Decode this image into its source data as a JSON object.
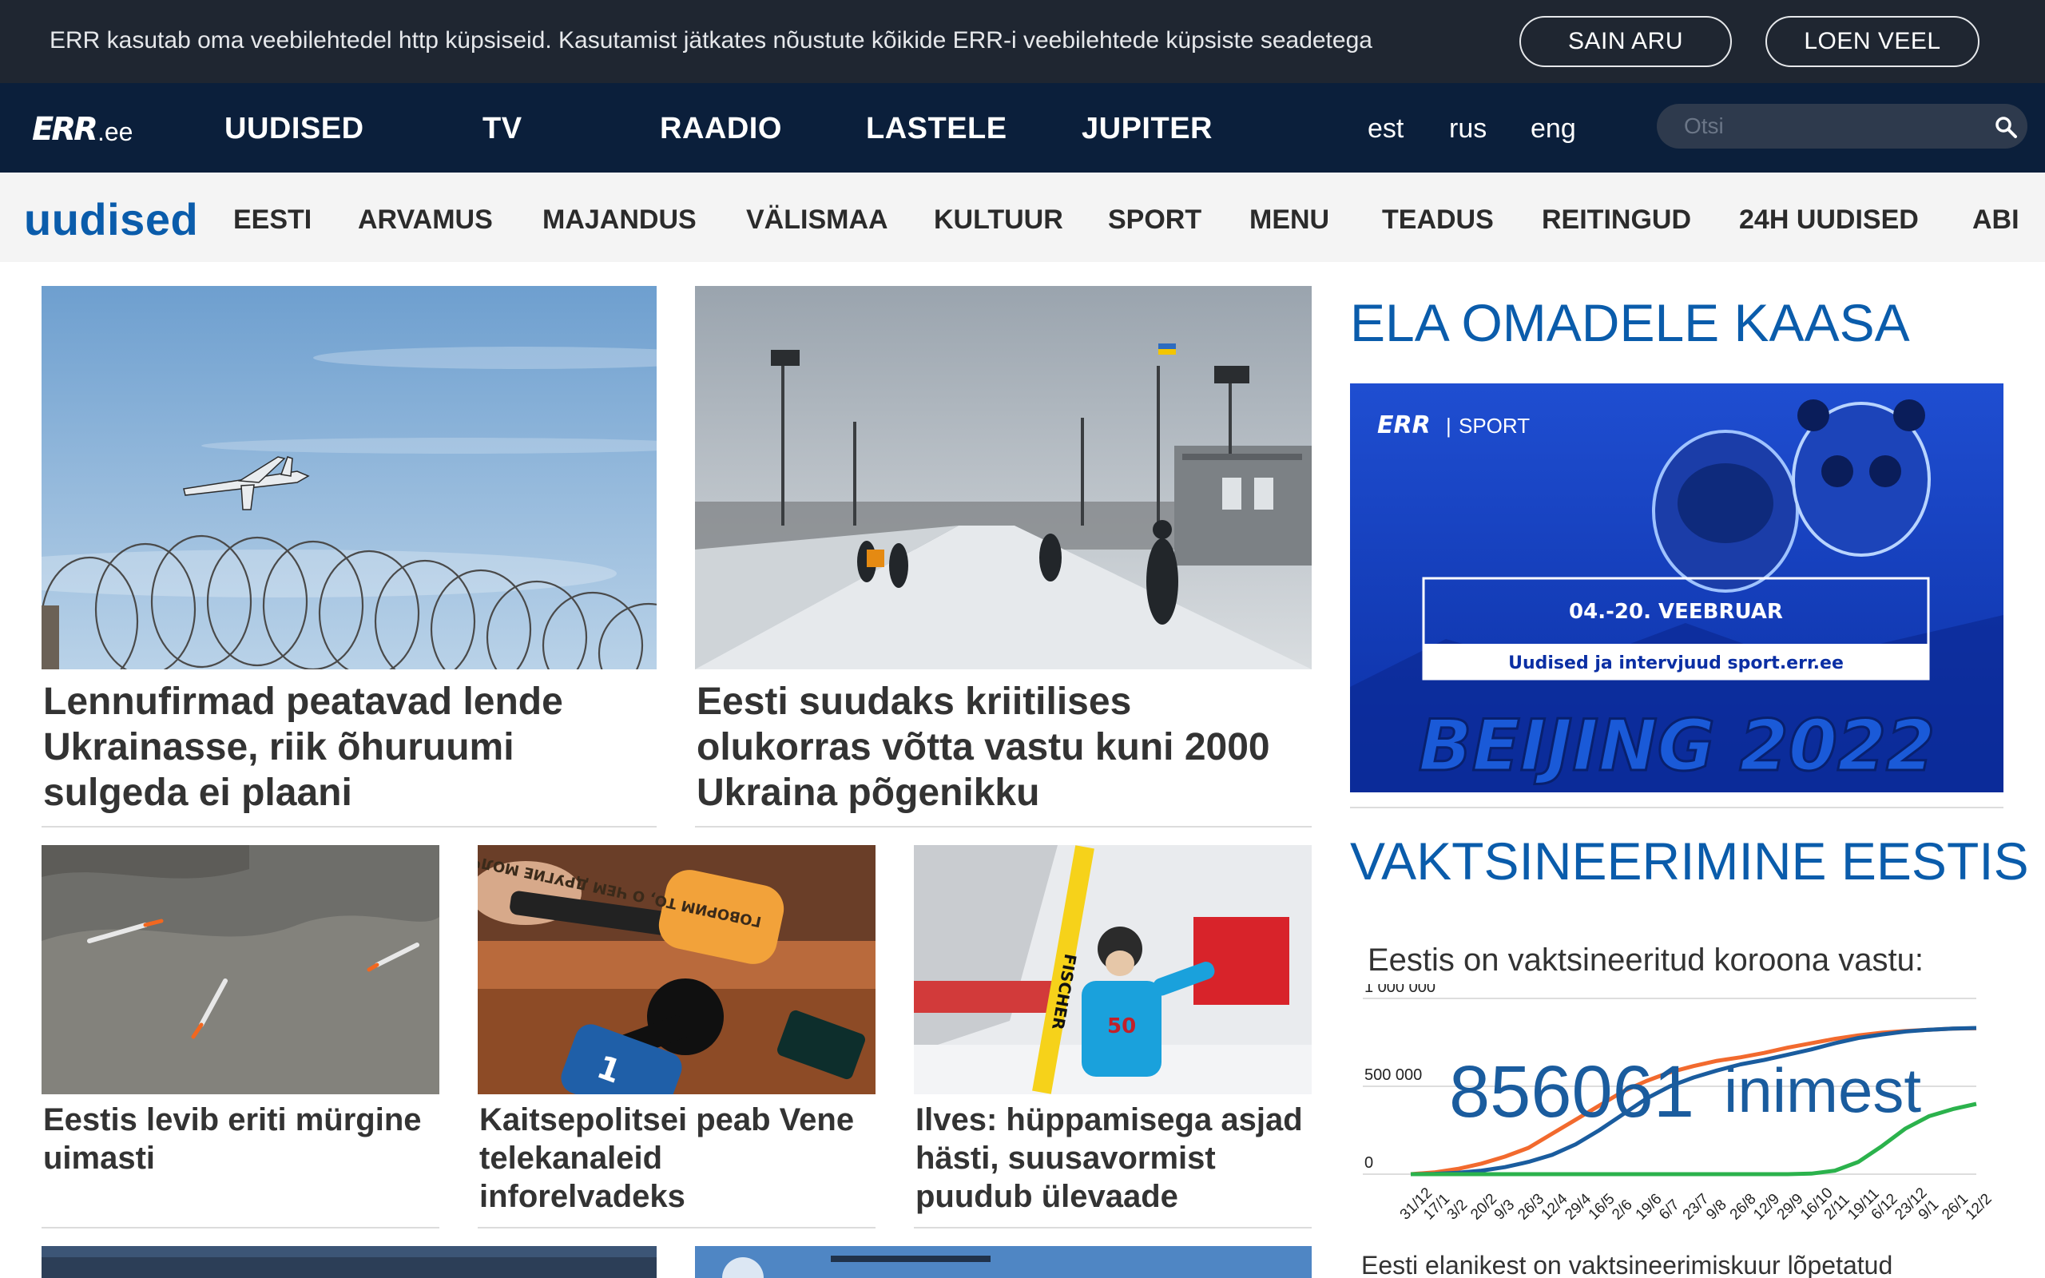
{
  "cookie": {
    "text": "ERR kasutab oma veebilehtedel http küpsiseid. Kasutamist jätkates nõustute kõikide ERR-i veebilehtede küpsiste seadetega",
    "accept_label": "SAIN ARU",
    "more_label": "LOEN VEEL"
  },
  "header": {
    "logo_mark": "ERR",
    "logo_suffix": ".ee",
    "nav": [
      "UUDISED",
      "TV",
      "RAADIO",
      "LASTELE",
      "JUPITER"
    ],
    "languages": [
      "est",
      "rus",
      "eng"
    ],
    "search_placeholder": "Otsi"
  },
  "section": {
    "title": "uudised",
    "items": [
      "EESTI",
      "ARVAMUS",
      "MAJANDUS",
      "VÄLISMAA",
      "KULTUUR",
      "SPORT",
      "MENU",
      "TEADUS",
      "REITINGUD",
      "24H UUDISED",
      "ABI"
    ]
  },
  "articles": {
    "lead1": {
      "title": "Lennufirmad peatavad lende Ukrainasse, riik õhuruumi sulgeda ei plaani"
    },
    "lead2": {
      "title": "Eesti suudaks kriitilises olukorras võtta vastu kuni 2000 Ukraina põgenikku"
    },
    "small1": {
      "title": "Eestis levib eriti mürgine uimasti"
    },
    "small2": {
      "title": "Kaitsepolitsei peab Vene telekanaleid inforelvadeks"
    },
    "small3": {
      "title": "Ilves: hüppamisega asjad hästi, suusavormist puudub ülevaade"
    },
    "mic_text": "ГОВОРИМ ТО, О ЧЕМ ДРУГИЕ МОЛЧАТ",
    "ski_bib": "50",
    "ski_brand": "FISCHER"
  },
  "sidebar": {
    "promo_heading": "ELA OMADELE KAASA",
    "promo": {
      "brand": "ERR",
      "brand_section": "SPORT",
      "dates": "04.-20. VEEBRUAR",
      "subtitle": "Uudised ja intervjuud sport.err.ee",
      "event": "BEIJING 2022"
    },
    "vax_heading": "VAKTSINEERIMINE EESTIS",
    "vax_text": "Eestis on vaktsineeritud koroona vastu:",
    "vax_count": "856061",
    "vax_unit": "inimest",
    "vax_footer": "Eesti elanikest on vaktsineerimiskuur lõpetatud"
  },
  "chart_data": {
    "type": "line",
    "title": "Eestis on vaktsineeritud koroona vastu:",
    "xlabel": "",
    "ylabel": "",
    "ylim": [
      0,
      1000000
    ],
    "yticks": [
      {
        "value": 0,
        "label": "0"
      },
      {
        "value": 500000,
        "label": "500 000"
      },
      {
        "value": 1000000,
        "label": "1 000 000"
      }
    ],
    "x": [
      "31/12",
      "17/1",
      "3/2",
      "20/2",
      "9/3",
      "26/3",
      "12/4",
      "29/4",
      "16/5",
      "2/6",
      "19/6",
      "6/7",
      "23/7",
      "9/8",
      "26/8",
      "12/9",
      "29/9",
      "16/10",
      "2/11",
      "19/11",
      "6/12",
      "23/12",
      "9/1",
      "26/1",
      "12/2"
    ],
    "grid": true,
    "series": [
      {
        "color": "#f26a2e",
        "values": [
          0,
          10000,
          30000,
          60000,
          100000,
          150000,
          230000,
          310000,
          390000,
          470000,
          530000,
          580000,
          615000,
          645000,
          665000,
          690000,
          720000,
          745000,
          770000,
          790000,
          805000,
          815000,
          822000,
          828000,
          830000
        ]
      },
      {
        "color": "#1a5c9e",
        "values": [
          0,
          2000,
          8000,
          20000,
          40000,
          70000,
          110000,
          170000,
          250000,
          340000,
          430000,
          500000,
          550000,
          590000,
          625000,
          650000,
          680000,
          710000,
          745000,
          775000,
          795000,
          812000,
          822000,
          828000,
          832000
        ]
      },
      {
        "color": "#2bb24c",
        "values": [
          0,
          0,
          0,
          0,
          0,
          0,
          0,
          0,
          0,
          0,
          0,
          0,
          0,
          0,
          0,
          0,
          0,
          3000,
          20000,
          70000,
          160000,
          260000,
          330000,
          370000,
          400000
        ]
      }
    ]
  }
}
